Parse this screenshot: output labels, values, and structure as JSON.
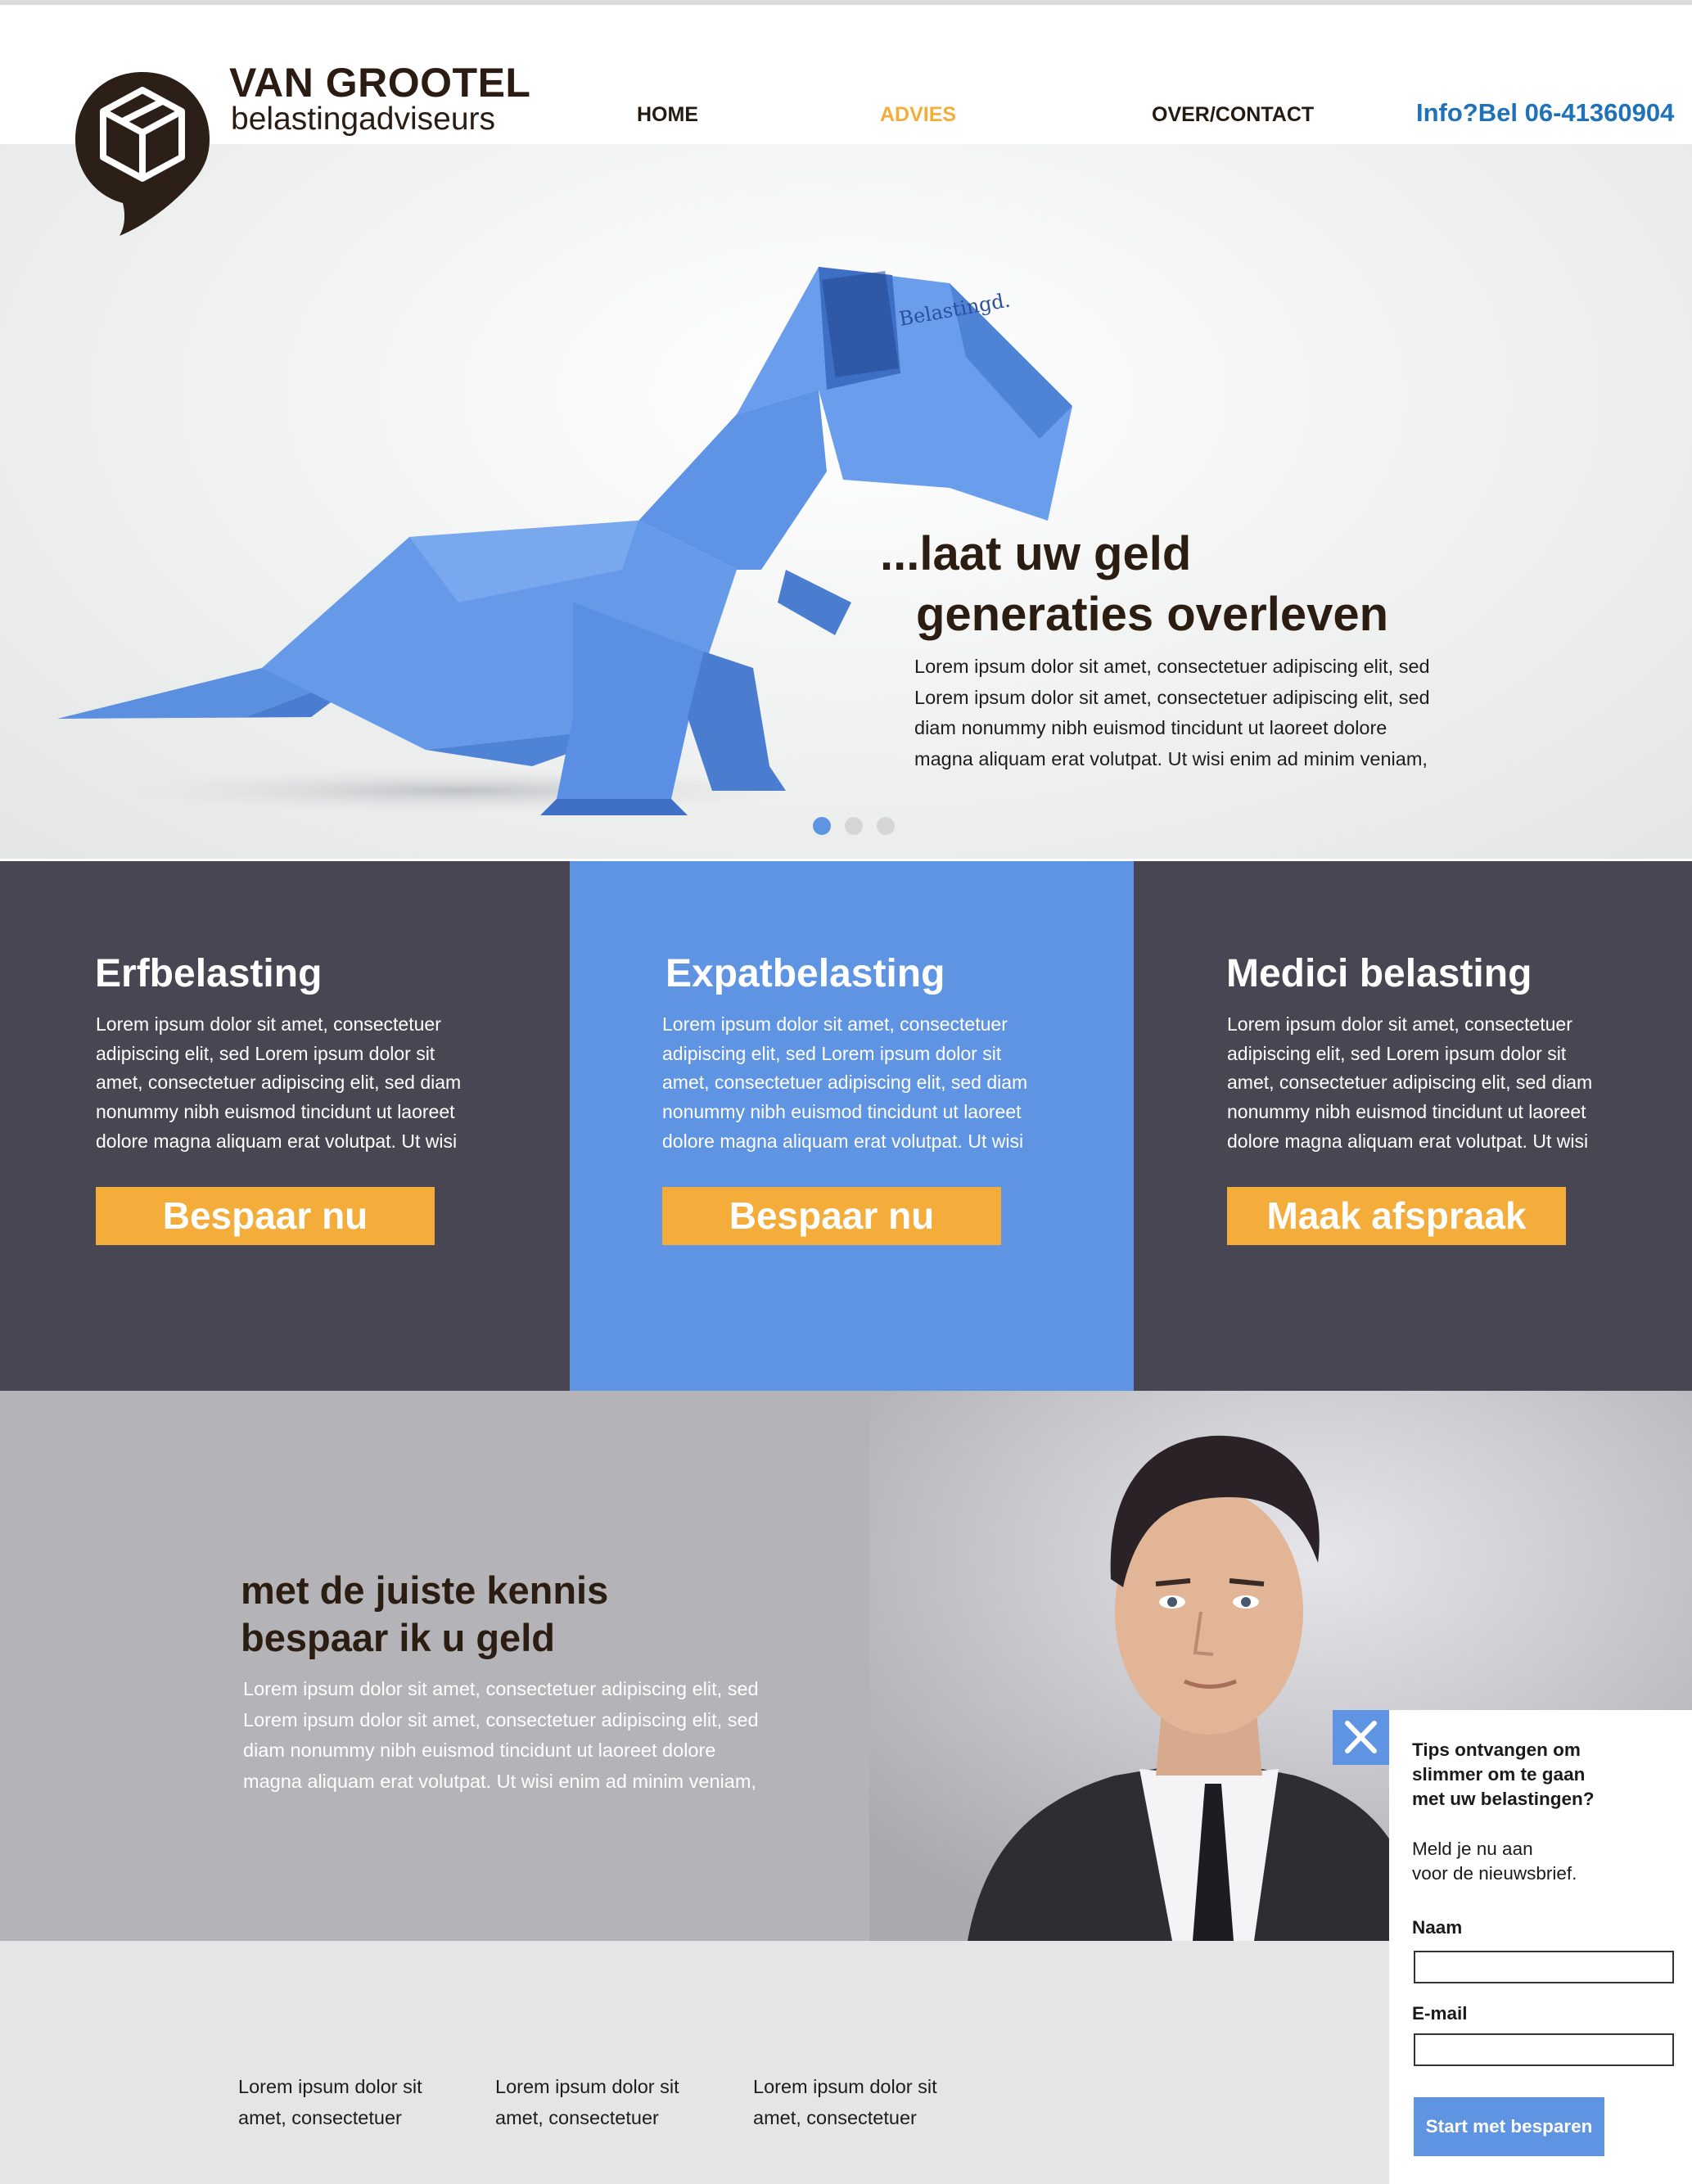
{
  "brand": {
    "name": "VAN GROOTEL",
    "subtitle": "belastingadviseurs",
    "accent": "#f4ad3b",
    "blue": "#5f94e3",
    "dark": "#2c1d12"
  },
  "nav": {
    "items": [
      {
        "label": "HOME",
        "active": false
      },
      {
        "label": "ADVIES",
        "active": true
      },
      {
        "label": "OVER/CONTACT",
        "active": false
      }
    ],
    "phone": "Info?Bel 06-41360904"
  },
  "hero": {
    "title_line1": "...laat uw geld",
    "title_line2": "generaties overleven",
    "paper_label": "Belastingd.",
    "body": [
      "Lorem ipsum dolor sit amet, consectetuer adipiscing elit, sed",
      "Lorem ipsum dolor sit amet, consectetuer adipiscing elit, sed",
      "diam nonummy nibh euismod tincidunt ut laoreet dolore",
      "magna aliquam erat volutpat. Ut wisi enim ad minim veniam,"
    ],
    "slides": {
      "count": 3,
      "active": 1
    }
  },
  "services": [
    {
      "title": "Erfbelasting",
      "body": [
        "Lorem ipsum dolor sit amet, consectetuer",
        "adipiscing elit, sed Lorem ipsum dolor sit",
        "amet, consectetuer adipiscing elit, sed diam",
        "nonummy nibh euismod tincidunt ut laoreet",
        "dolore magna aliquam erat volutpat. Ut wisi"
      ],
      "button": "Bespaar nu",
      "bg": "#484653"
    },
    {
      "title": "Expatbelasting",
      "body": [
        "Lorem ipsum dolor sit amet, consectetuer",
        "adipiscing elit, sed Lorem ipsum dolor sit",
        "amet, consectetuer adipiscing elit, sed diam",
        "nonummy nibh euismod tincidunt ut laoreet",
        "dolore magna aliquam erat volutpat. Ut wisi"
      ],
      "button": "Bespaar nu",
      "bg": "#5f94e3"
    },
    {
      "title": "Medici belasting",
      "body": [
        "Lorem ipsum dolor sit amet, consectetuer",
        "adipiscing elit, sed Lorem ipsum dolor sit",
        "amet, consectetuer adipiscing elit, sed diam",
        "nonummy nibh euismod tincidunt ut laoreet",
        "dolore magna aliquam erat volutpat. Ut wisi"
      ],
      "button": "Maak afspraak",
      "bg": "#484653"
    }
  ],
  "about": {
    "title_line1": "met de juiste kennis",
    "title_line2": "bespaar ik u geld",
    "body": [
      "Lorem ipsum dolor sit amet, consectetuer adipiscing elit, sed",
      "Lorem ipsum dolor sit amet, consectetuer adipiscing elit, sed",
      "diam nonummy nibh euismod tincidunt ut laoreet dolore",
      "magna aliquam erat volutpat. Ut wisi enim ad minim veniam,"
    ]
  },
  "footer": {
    "columns": [
      [
        "Lorem ipsum dolor sit",
        "amet, consectetuer"
      ],
      [
        "Lorem ipsum dolor sit",
        "amet, consectetuer"
      ],
      [
        "Lorem ipsum dolor sit",
        "amet, consectetuer"
      ]
    ]
  },
  "newsletter": {
    "title": [
      "Tips ontvangen om",
      "slimmer om te gaan",
      "met uw belastingen?"
    ],
    "subtitle": [
      "Meld je nu aan",
      "voor de nieuwsbrief."
    ],
    "name_label": "Naam",
    "name_value": "",
    "email_label": "E-mail",
    "email_value": "",
    "submit": "Start met besparen"
  }
}
